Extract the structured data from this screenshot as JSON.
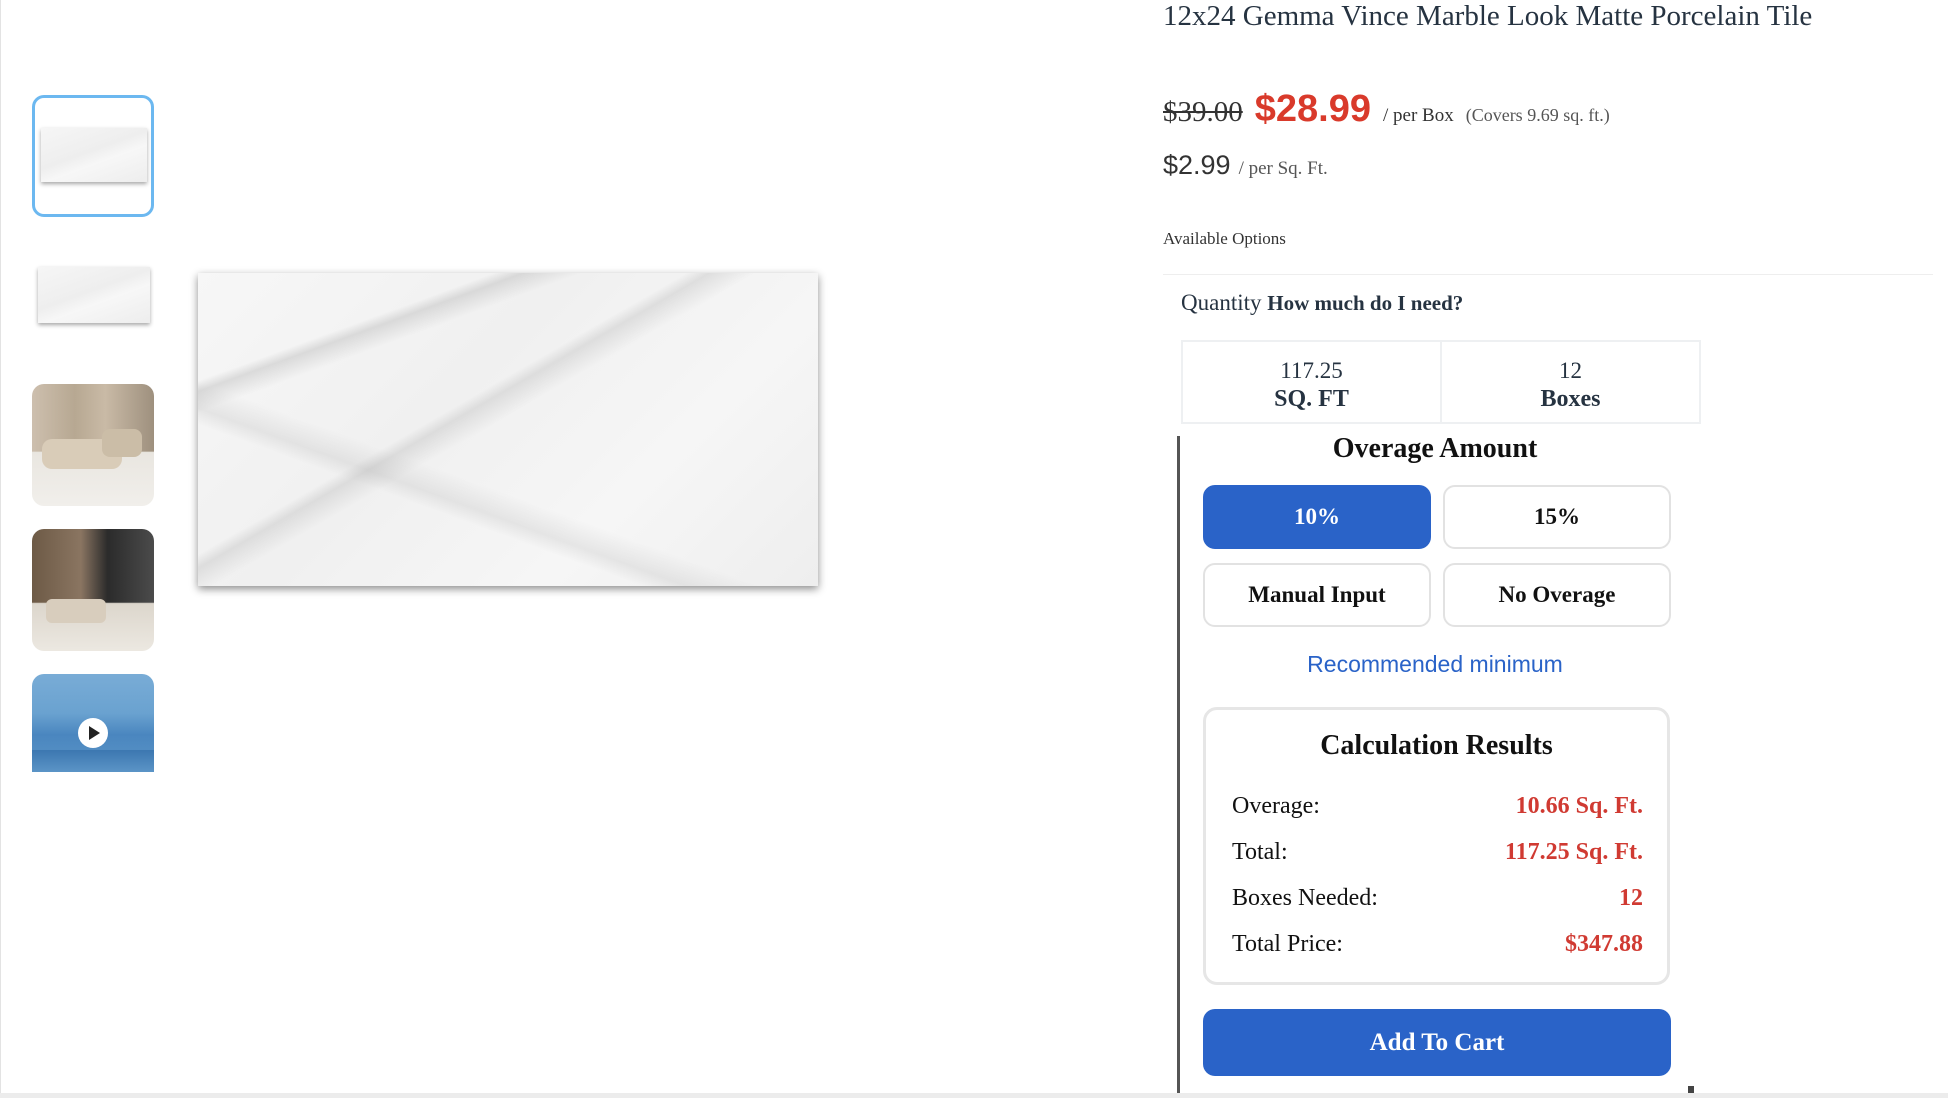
{
  "product": {
    "title": "12x24 Gemma Vince Marble Look Matte Porcelain Tile",
    "old_price": "$39.00",
    "sale_price": "$28.99",
    "per_box": "/ per Box",
    "covers": "(Covers 9.69 sq. ft.)",
    "sqft_price": "$2.99",
    "per_sqft": "/ per Sq. Ft.",
    "available_options": "Available Options"
  },
  "gallery": {
    "thumbnails": [
      "tile-image",
      "tile-image-flat",
      "living-room-photo",
      "interior-photo",
      "video"
    ],
    "active_index": 0
  },
  "quantity": {
    "label": "Quantity",
    "help": "How much do I need?",
    "sqft_value": "117.25",
    "sqft_unit": "SQ. FT",
    "boxes_value": "12",
    "boxes_unit": "Boxes"
  },
  "overage": {
    "heading": "Overage Amount",
    "options": [
      "10%",
      "15%",
      "Manual Input",
      "No Overage"
    ],
    "selected": "10%",
    "recommended": "Recommended minimum"
  },
  "results": {
    "title": "Calculation Results",
    "rows": [
      {
        "label": "Overage:",
        "value": "10.66 Sq. Ft."
      },
      {
        "label": "Total:",
        "value": "117.25 Sq. Ft."
      },
      {
        "label": "Boxes Needed:",
        "value": "12"
      },
      {
        "label": "Total Price:",
        "value": "$347.88"
      }
    ]
  },
  "cart": {
    "label": "Add To Cart"
  },
  "colors": {
    "accent": "#2a63c8",
    "sale": "#d93a2b",
    "result_value": "#d03a32"
  }
}
